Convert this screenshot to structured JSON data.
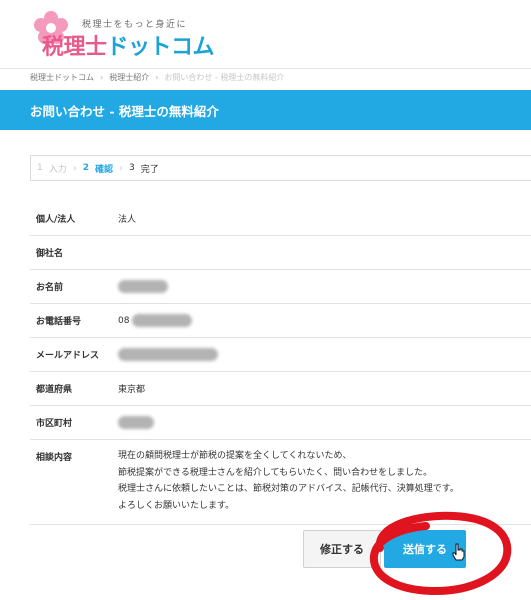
{
  "header": {
    "tagline": "税理士をもっと身近に",
    "logo_name_part1": "税理士",
    "logo_name_part2": "ドットコム"
  },
  "breadcrumb": {
    "items": [
      "税理士ドットコム",
      "税理士紹介",
      "お問い合わせ - 税理士の無料紹介"
    ]
  },
  "page_title": "お問い合わせ - 税理士の無料紹介",
  "steps": [
    {
      "num": "1",
      "label": "入力"
    },
    {
      "num": "2",
      "label": "確認"
    },
    {
      "num": "3",
      "label": "完了"
    }
  ],
  "form": {
    "rows": [
      {
        "label": "個人/法人",
        "value": "法人"
      },
      {
        "label": "御社名",
        "value": ""
      },
      {
        "label": "お名前",
        "value": ""
      },
      {
        "label": "お電話番号",
        "value": "08"
      },
      {
        "label": "メールアドレス",
        "value": ""
      },
      {
        "label": "都道府県",
        "value": "東京都"
      },
      {
        "label": "市区町村",
        "value": ""
      },
      {
        "label": "相談内容",
        "lines": [
          "現在の顧問税理士が節税の提案を全くしてくれないため、",
          "節税提案ができる税理士さんを紹介してもらいたく、問い合わせをしました。",
          "税理士さんに依頼したいことは、節税対策のアドバイス、記帳代行、決算処理です。",
          "よろしくお願いいたします。"
        ]
      }
    ]
  },
  "buttons": {
    "edit": "修正する",
    "send": "送信する"
  },
  "colors": {
    "accent": "#22a8e2",
    "brand_pink": "#e85a8b",
    "annotation_red": "#e0141e"
  }
}
